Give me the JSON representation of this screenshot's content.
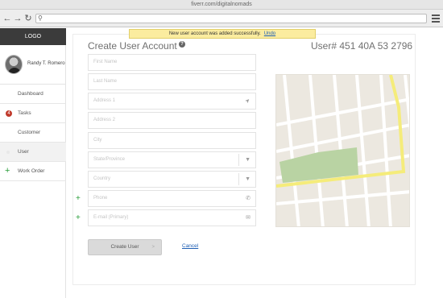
{
  "browser": {
    "title": "fiverr.com/digitalnomads",
    "back_glyph": "←",
    "forward_glyph": "→",
    "reload_glyph": "↻",
    "search_glyph": "⚲",
    "menu_icon": "hamburger-icon"
  },
  "sidebar": {
    "logo": "LOGO",
    "user_name": "Randy T. Romero",
    "items": [
      {
        "label": "Dashboard",
        "marker": "none"
      },
      {
        "label": "Tasks",
        "marker": "badge",
        "badge": "4"
      },
      {
        "label": "Customer",
        "marker": "none"
      },
      {
        "label": "User",
        "marker": "dot",
        "active": true
      },
      {
        "label": "Work Order",
        "marker": "plus",
        "plus": "+"
      }
    ]
  },
  "banner": {
    "message": "New user account was added successfully.",
    "undo_label": "Undo"
  },
  "form": {
    "title": "Create User Account",
    "help_glyph": "?",
    "user_id": "User# 451 40A 53 2796",
    "fields": [
      {
        "placeholder": "First Name",
        "icon": "none"
      },
      {
        "placeholder": "Last Name",
        "icon": "none"
      },
      {
        "placeholder": "Address 1",
        "icon": "location-arrow-icon",
        "glyph": "➤"
      },
      {
        "placeholder": "Address 2",
        "icon": "none"
      },
      {
        "placeholder": "City",
        "icon": "none"
      },
      {
        "placeholder": "State/Province",
        "icon": "dropdown-triangle-icon",
        "glyph": "▼"
      },
      {
        "placeholder": "Country",
        "icon": "dropdown-triangle-icon",
        "glyph": "▼"
      },
      {
        "placeholder": "Phone",
        "icon": "phone-icon",
        "glyph": "✆"
      },
      {
        "placeholder": "E-mail (Primary)",
        "icon": "mail-icon",
        "glyph": "✉"
      }
    ],
    "plus_glyph": "+",
    "create_button": "Create User",
    "create_arrow": ">",
    "cancel_link": "Cancel"
  },
  "map": {
    "road_color": "#ffffff",
    "route_color": "#f5ec7a",
    "park_color": "#b9d3a3",
    "land_color": "#ece8e0"
  }
}
